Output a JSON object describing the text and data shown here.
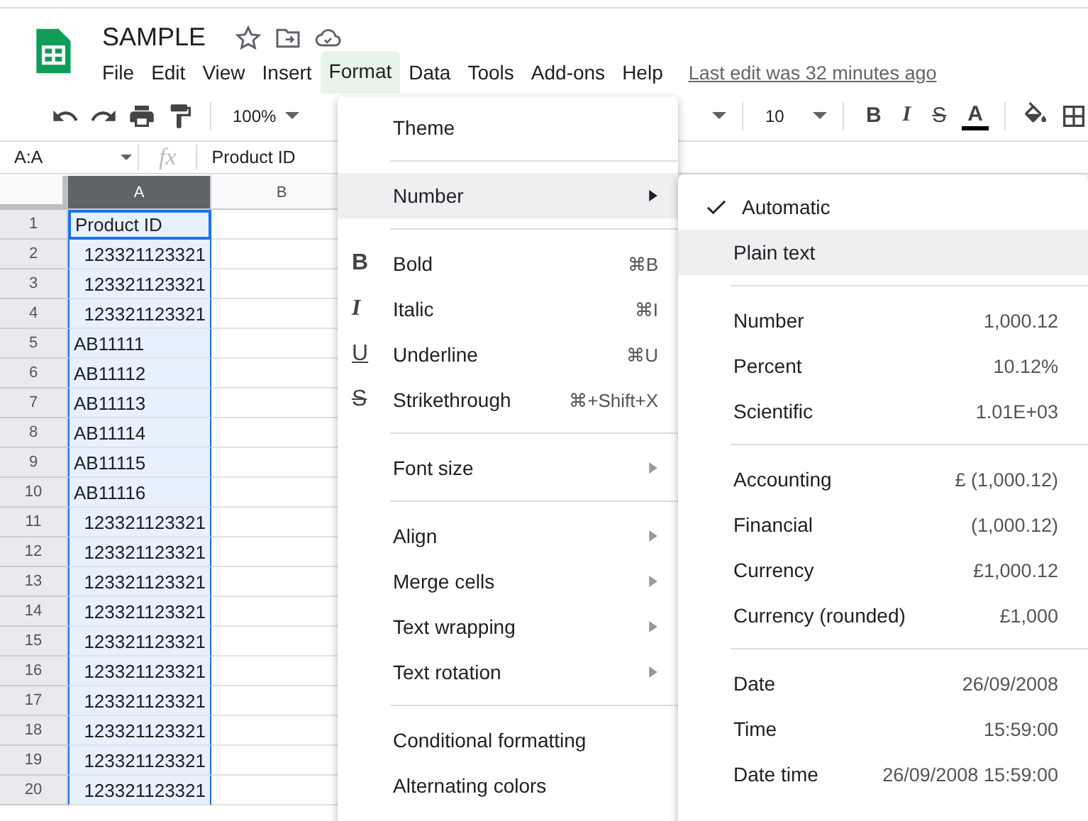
{
  "app": {
    "title": "SAMPLE",
    "last_edit": "Last edit was 32 minutes ago"
  },
  "menubar": [
    {
      "label": "File",
      "selected": false
    },
    {
      "label": "Edit",
      "selected": false
    },
    {
      "label": "View",
      "selected": false
    },
    {
      "label": "Insert",
      "selected": false
    },
    {
      "label": "Format",
      "selected": true
    },
    {
      "label": "Data",
      "selected": false
    },
    {
      "label": "Tools",
      "selected": false
    },
    {
      "label": "Add-ons",
      "selected": false
    },
    {
      "label": "Help",
      "selected": false
    }
  ],
  "toolbar": {
    "zoom": "100%",
    "font_size": "10",
    "format_buttons": [
      {
        "glyph": "B",
        "kind": "bold"
      },
      {
        "glyph": "I",
        "kind": "italic"
      },
      {
        "glyph": "S",
        "kind": "strikethrough"
      },
      {
        "glyph": "A",
        "kind": "text-color"
      }
    ]
  },
  "formula_bar": {
    "name_box": "A:A",
    "fx": "fx",
    "value": "Product ID"
  },
  "columns": [
    {
      "label": "A",
      "selected": true
    },
    {
      "label": "B",
      "selected": false
    }
  ],
  "rows": [
    {
      "number": "1",
      "cell": "Product ID",
      "kind": "text",
      "active": true
    },
    {
      "number": "2",
      "cell": "123321123321",
      "kind": "number",
      "active": false
    },
    {
      "number": "3",
      "cell": "123321123321",
      "kind": "number",
      "active": false
    },
    {
      "number": "4",
      "cell": "123321123321",
      "kind": "number",
      "active": false
    },
    {
      "number": "5",
      "cell": "AB11111",
      "kind": "text",
      "active": false
    },
    {
      "number": "6",
      "cell": "AB11112",
      "kind": "text",
      "active": false
    },
    {
      "number": "7",
      "cell": "AB11113",
      "kind": "text",
      "active": false
    },
    {
      "number": "8",
      "cell": "AB11114",
      "kind": "text",
      "active": false
    },
    {
      "number": "9",
      "cell": "AB11115",
      "kind": "text",
      "active": false
    },
    {
      "number": "10",
      "cell": "AB11116",
      "kind": "text",
      "active": false
    },
    {
      "number": "11",
      "cell": "123321123321",
      "kind": "number",
      "active": false
    },
    {
      "number": "12",
      "cell": "123321123321",
      "kind": "number",
      "active": false
    },
    {
      "number": "13",
      "cell": "123321123321",
      "kind": "number",
      "active": false
    },
    {
      "number": "14",
      "cell": "123321123321",
      "kind": "number",
      "active": false
    },
    {
      "number": "15",
      "cell": "123321123321",
      "kind": "number",
      "active": false
    },
    {
      "number": "16",
      "cell": "123321123321",
      "kind": "number",
      "active": false
    },
    {
      "number": "17",
      "cell": "123321123321",
      "kind": "number",
      "active": false
    },
    {
      "number": "18",
      "cell": "123321123321",
      "kind": "number",
      "active": false
    },
    {
      "number": "19",
      "cell": "123321123321",
      "kind": "number",
      "active": false
    },
    {
      "number": "20",
      "cell": "123321123321",
      "kind": "number",
      "active": false
    }
  ],
  "format_menu": [
    [
      {
        "label": "Theme",
        "submenu": false,
        "selected": false
      }
    ],
    [
      {
        "label": "Number",
        "submenu": true,
        "selected": true
      }
    ],
    [
      {
        "label": "Bold",
        "kind": "bold",
        "icon": "B",
        "shortcut": "⌘B",
        "submenu": false,
        "selected": false
      },
      {
        "label": "Italic",
        "kind": "italic",
        "icon": "I",
        "shortcut": "⌘I",
        "submenu": false,
        "selected": false
      },
      {
        "label": "Underline",
        "kind": "underline",
        "icon": "U",
        "shortcut": "⌘U",
        "submenu": false,
        "selected": false
      },
      {
        "label": "Strikethrough",
        "kind": "strikethrough",
        "icon": "S",
        "shortcut": "⌘+Shift+X",
        "submenu": false,
        "selected": false
      }
    ],
    [
      {
        "label": "Font size",
        "submenu": true,
        "selected": false
      }
    ],
    [
      {
        "label": "Align",
        "submenu": true,
        "selected": false
      },
      {
        "label": "Merge cells",
        "submenu": true,
        "selected": false
      },
      {
        "label": "Text wrapping",
        "submenu": true,
        "selected": false
      },
      {
        "label": "Text rotation",
        "submenu": true,
        "selected": false
      }
    ],
    [
      {
        "label": "Conditional formatting",
        "submenu": false,
        "selected": false
      },
      {
        "label": "Alternating colors",
        "submenu": false,
        "selected": false
      }
    ]
  ],
  "number_menu": [
    [
      {
        "label": "Automatic",
        "checked": true,
        "selected": false
      },
      {
        "label": "Plain text",
        "checked": false,
        "selected": true
      }
    ],
    [
      {
        "label": "Number",
        "example": "1,000.12",
        "checked": false,
        "selected": false
      },
      {
        "label": "Percent",
        "example": "10.12%",
        "checked": false,
        "selected": false
      },
      {
        "label": "Scientific",
        "example": "1.01E+03",
        "checked": false,
        "selected": false
      }
    ],
    [
      {
        "label": "Accounting",
        "example": "£ (1,000.12)",
        "checked": false,
        "selected": false
      },
      {
        "label": "Financial",
        "example": "(1,000.12)",
        "checked": false,
        "selected": false
      },
      {
        "label": "Currency",
        "example": "£1,000.12",
        "checked": false,
        "selected": false
      },
      {
        "label": "Currency (rounded)",
        "example": "£1,000",
        "checked": false,
        "selected": false
      }
    ],
    [
      {
        "label": "Date",
        "example": "26/09/2008",
        "checked": false,
        "selected": false
      },
      {
        "label": "Time",
        "example": "15:59:00",
        "checked": false,
        "selected": false
      },
      {
        "label": "Date time",
        "example": "26/09/2008 15:59:00",
        "checked": false,
        "selected": false
      }
    ]
  ]
}
